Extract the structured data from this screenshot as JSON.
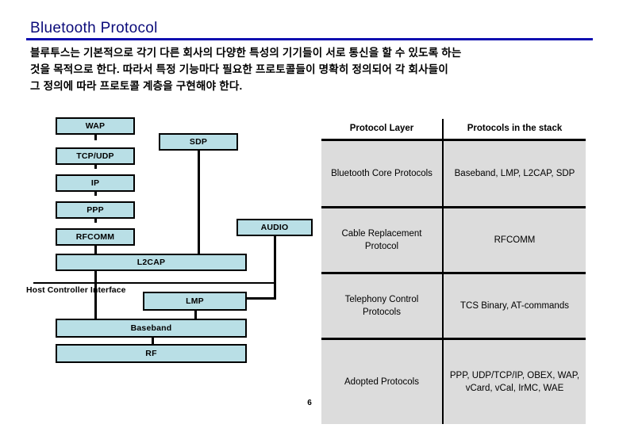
{
  "slide": {
    "title": "Bluetooth Protocol",
    "page_number": "6",
    "accent_color": "#1010b0",
    "box_fill_color": "#b9dfe6",
    "table_cell_color": "#dcdcdc"
  },
  "body_text": {
    "line1": "블루투스는 기본적으로 각기 다른 회사의 다양한 특성의 기기들이 서로 통신을 할 수 있도록 하는",
    "line2": "것을 목적으로 한다. 따라서 특정 기능마다 필요한 프로토콜들이 명확히 정의되어 각 회사들이",
    "line3": "그 정의에 따라 프로토콜 계층을 구현해야 한다."
  },
  "diagram": {
    "hci_label": "Host Controller Interface",
    "boxes": [
      {
        "id": "wap",
        "label": "WAP"
      },
      {
        "id": "sdp",
        "label": "SDP"
      },
      {
        "id": "tcpudp",
        "label": "TCP/UDP"
      },
      {
        "id": "ip",
        "label": "IP"
      },
      {
        "id": "ppp",
        "label": "PPP"
      },
      {
        "id": "audio",
        "label": "AUDIO"
      },
      {
        "id": "rfcomm",
        "label": "RFCOMM"
      },
      {
        "id": "l2cap",
        "label": "L2CAP"
      },
      {
        "id": "lmp",
        "label": "LMP"
      },
      {
        "id": "baseband",
        "label": "Baseband"
      },
      {
        "id": "rf",
        "label": "RF"
      }
    ]
  },
  "table": {
    "headers": [
      "Protocol Layer",
      "Protocols in the stack"
    ],
    "rows": [
      {
        "layer": "Bluetooth Core Protocols",
        "protocols": "Baseband, LMP, L2CAP, SDP"
      },
      {
        "layer": "Cable Replacement Protocol",
        "protocols": "RFCOMM"
      },
      {
        "layer": "Telephony Control Protocols",
        "protocols": "TCS Binary, AT-commands"
      },
      {
        "layer": "Adopted Protocols",
        "protocols": "PPP, UDP/TCP/IP, OBEX, WAP, vCard, vCal, IrMC, WAE"
      }
    ]
  }
}
